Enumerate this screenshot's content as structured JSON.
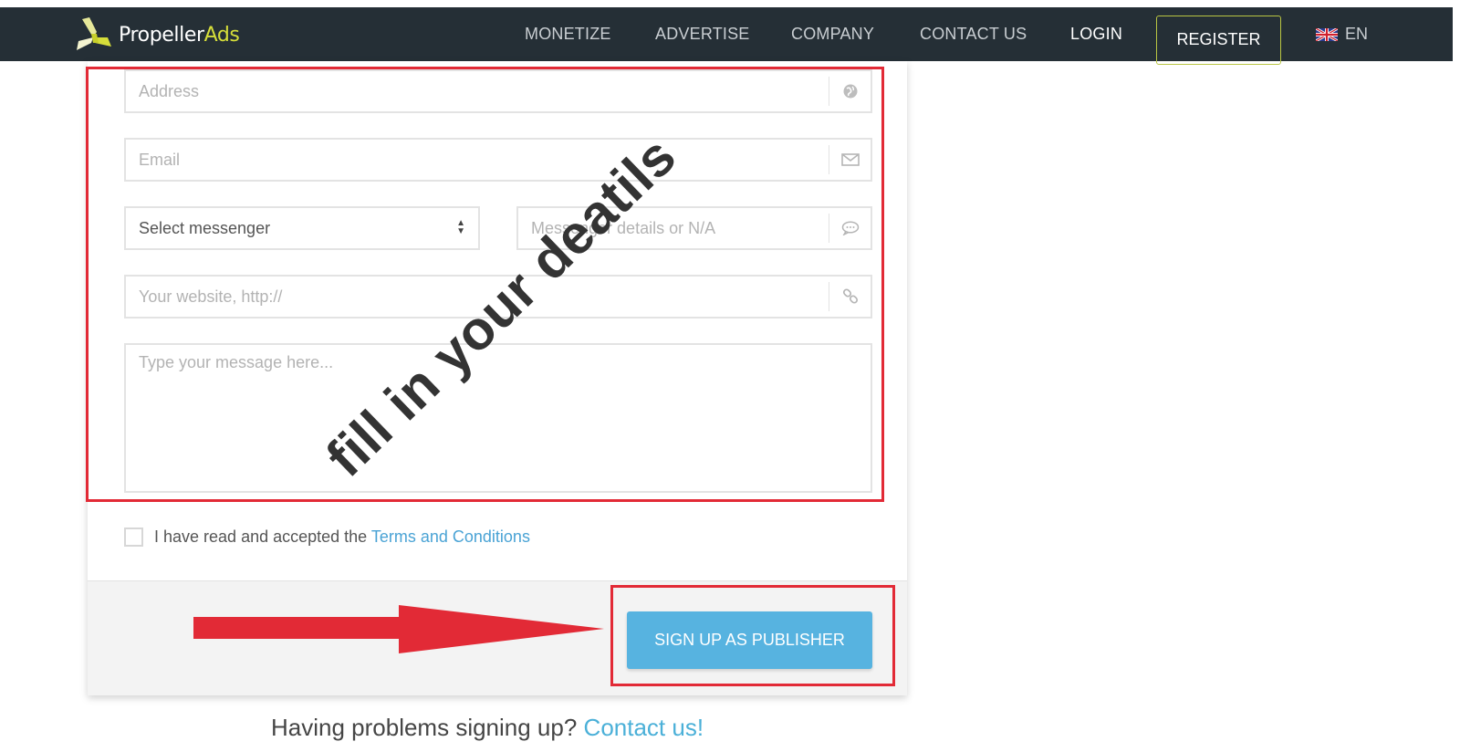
{
  "nav": {
    "brand_part1": "Propeller",
    "brand_part2": "Ads",
    "items": [
      "MONETIZE",
      "ADVERTISE",
      "COMPANY",
      "CONTACT US"
    ],
    "login": "LOGIN",
    "register": "REGISTER",
    "language": "EN"
  },
  "form": {
    "address_placeholder": "Address",
    "email_placeholder": "Email",
    "messenger_select_value": "Select messenger",
    "messenger_details_placeholder": "Messenger details or N/A",
    "website_placeholder": "Your website, http://",
    "message_placeholder": "Type your message here...",
    "terms_prefix": "I have read and accepted the ",
    "terms_link": "Terms and Conditions",
    "submit_label": "SIGN UP AS PUBLISHER"
  },
  "help": {
    "text": "Having problems signing up? ",
    "link": "Contact us!"
  },
  "annotation": {
    "overlay_text": "fill in your deatils"
  },
  "colors": {
    "navbar": "#252f36",
    "brand_accent": "#d6de3a",
    "button": "#57b3e0",
    "link": "#4aa3d5",
    "annotation_red": "#e22a36"
  }
}
